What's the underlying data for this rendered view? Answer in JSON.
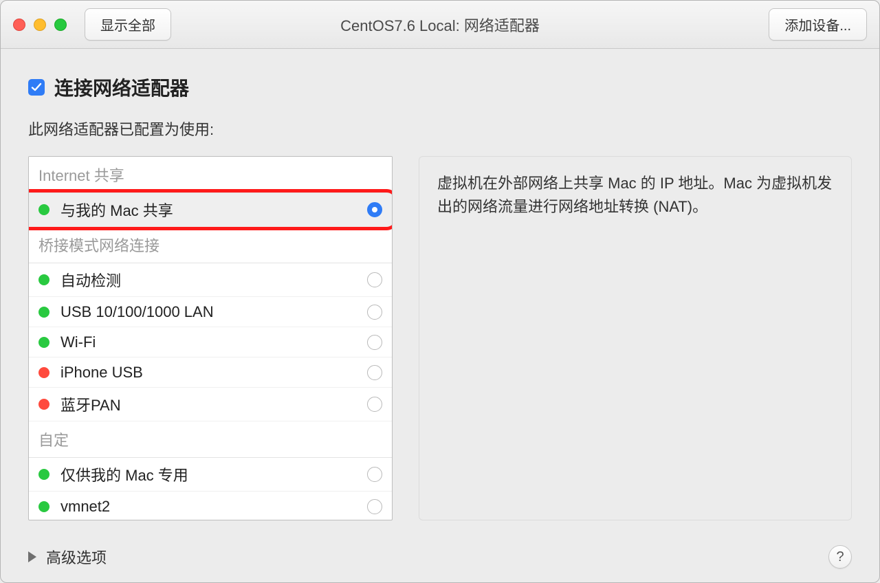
{
  "toolbar": {
    "show_all_label": "显示全部",
    "add_device_label": "添加设备..."
  },
  "window_title": "CentOS7.6 Local: 网络适配器",
  "connect_checkbox": {
    "checked": true,
    "label": "连接网络适配器"
  },
  "config_label": "此网络适配器已配置为使用:",
  "network_groups": [
    {
      "header": "Internet 共享",
      "options": [
        {
          "label": "与我的 Mac 共享",
          "status": "green",
          "selected": true,
          "highlighted": true
        }
      ]
    },
    {
      "header": "桥接模式网络连接",
      "options": [
        {
          "label": "自动检测",
          "status": "green",
          "selected": false
        },
        {
          "label": "USB 10/100/1000 LAN",
          "status": "green",
          "selected": false
        },
        {
          "label": "Wi-Fi",
          "status": "green",
          "selected": false
        },
        {
          "label": "iPhone USB",
          "status": "red",
          "selected": false
        },
        {
          "label": "蓝牙PAN",
          "status": "red",
          "selected": false
        }
      ]
    },
    {
      "header": "自定",
      "options": [
        {
          "label": "仅供我的 Mac 专用",
          "status": "green",
          "selected": false
        },
        {
          "label": "vmnet2",
          "status": "green",
          "selected": false
        }
      ]
    }
  ],
  "description_text": "虚拟机在外部网络上共享 Mac 的 IP 地址。Mac 为虚拟机发出的网络流量进行网络地址转换 (NAT)。",
  "advanced_label": "高级选项",
  "help_label": "?"
}
